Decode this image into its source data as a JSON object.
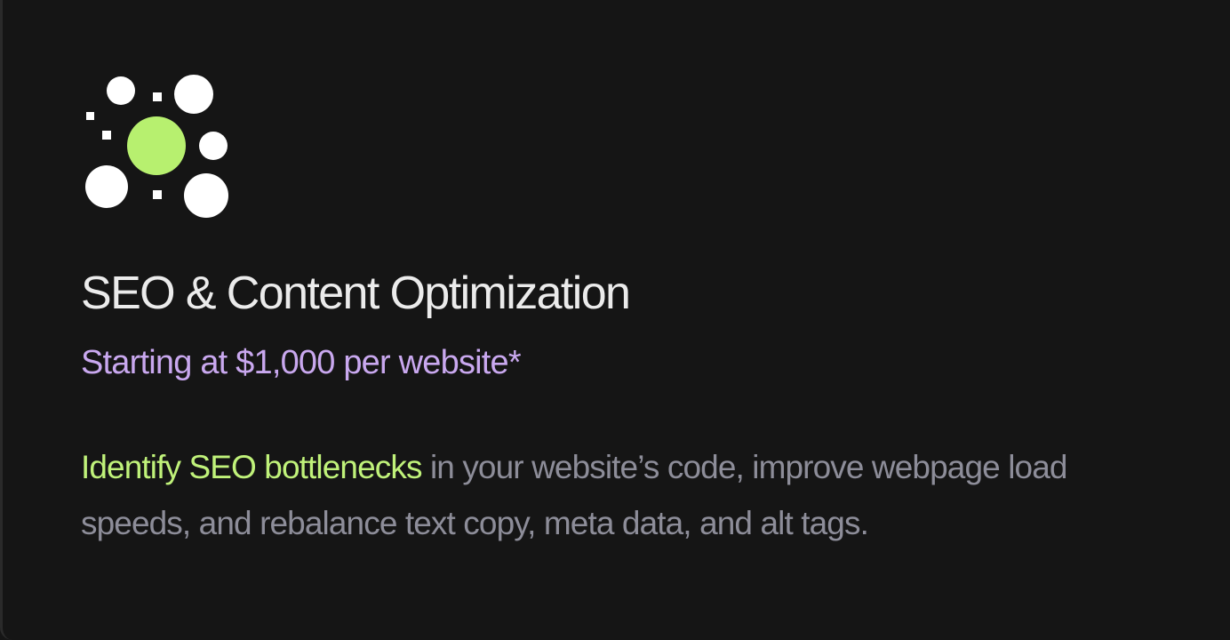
{
  "card": {
    "icon": "scatter-dots-icon",
    "title": "SEO & Content Optimization",
    "price": "Starting at $1,000 per website*",
    "description": {
      "highlight": "Identify SEO bottlenecks",
      "rest": " in your website’s code, improve webpage load speeds, and rebalance text copy, meta data, and alt tags."
    }
  },
  "colors": {
    "background": "#151515",
    "accent_green": "#b7f06f",
    "accent_purple": "#c9a8ef",
    "title": "#ebebeb",
    "body": "#8d8d99"
  }
}
